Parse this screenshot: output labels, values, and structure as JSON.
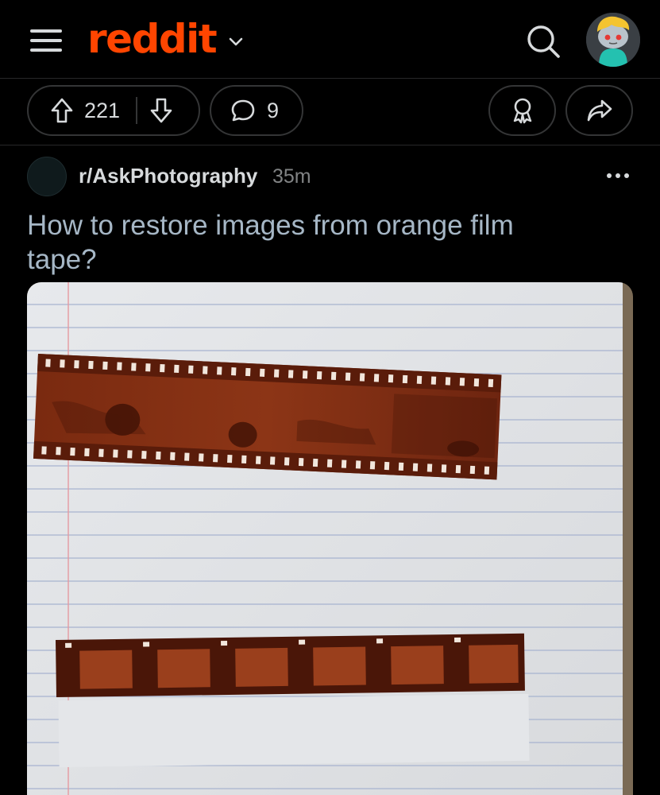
{
  "header": {
    "logo_text": "reddit",
    "brand_color": "#ff4500",
    "menu_icon": "hamburger-menu-icon",
    "search_icon": "search-icon",
    "avatar": "user-avatar"
  },
  "actions": {
    "upvote_icon": "upvote-arrow-icon",
    "vote_count": "221",
    "downvote_icon": "downvote-arrow-icon",
    "comment_icon": "comment-bubble-icon",
    "comment_count": "9",
    "award_icon": "award-icon",
    "share_icon": "share-arrow-icon"
  },
  "post": {
    "subreddit": "r/AskPhotography",
    "age": "35m",
    "title": "How to restore images from orange film tape?",
    "more_icon": "more-options-icon",
    "image_subject": "two orange film negative strips on lined notebook paper"
  }
}
